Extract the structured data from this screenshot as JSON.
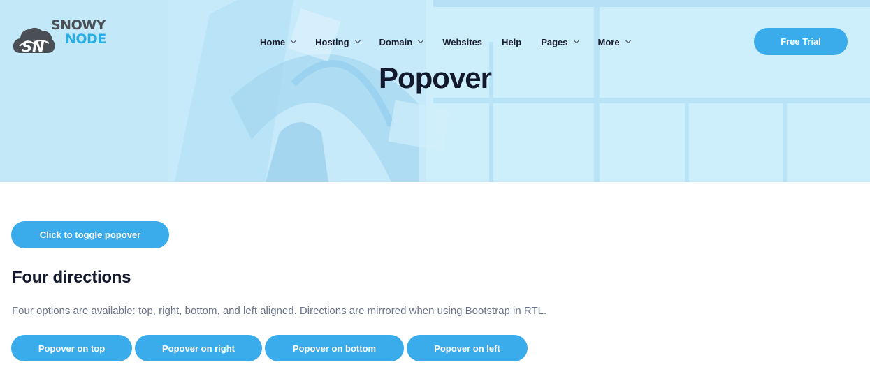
{
  "brand": {
    "logo_line1": "SNOWY",
    "logo_line2": "NODE",
    "logo_mark": "SN",
    "accent": "#3aaceb",
    "hero_bg": "#c9ecfb",
    "heading_color": "#141a2e"
  },
  "nav": {
    "items": [
      {
        "label": "Home",
        "has_dropdown": true
      },
      {
        "label": "Hosting",
        "has_dropdown": true
      },
      {
        "label": "Domain",
        "has_dropdown": true
      },
      {
        "label": "Websites",
        "has_dropdown": false
      },
      {
        "label": "Help",
        "has_dropdown": false
      },
      {
        "label": "Pages",
        "has_dropdown": true
      },
      {
        "label": "More",
        "has_dropdown": true
      }
    ],
    "cta_label": "Free Trial"
  },
  "hero": {
    "title": "Popover"
  },
  "content": {
    "toggle_button": "Click to toggle popover",
    "heading": "Four directions",
    "description": "Four options are available: top, right, bottom, and left aligned. Directions are mirrored when using Bootstrap in RTL.",
    "direction_buttons": [
      {
        "label": "Popover on top"
      },
      {
        "label": "Popover on right"
      },
      {
        "label": "Popover on bottom"
      },
      {
        "label": "Popover on left"
      }
    ]
  }
}
